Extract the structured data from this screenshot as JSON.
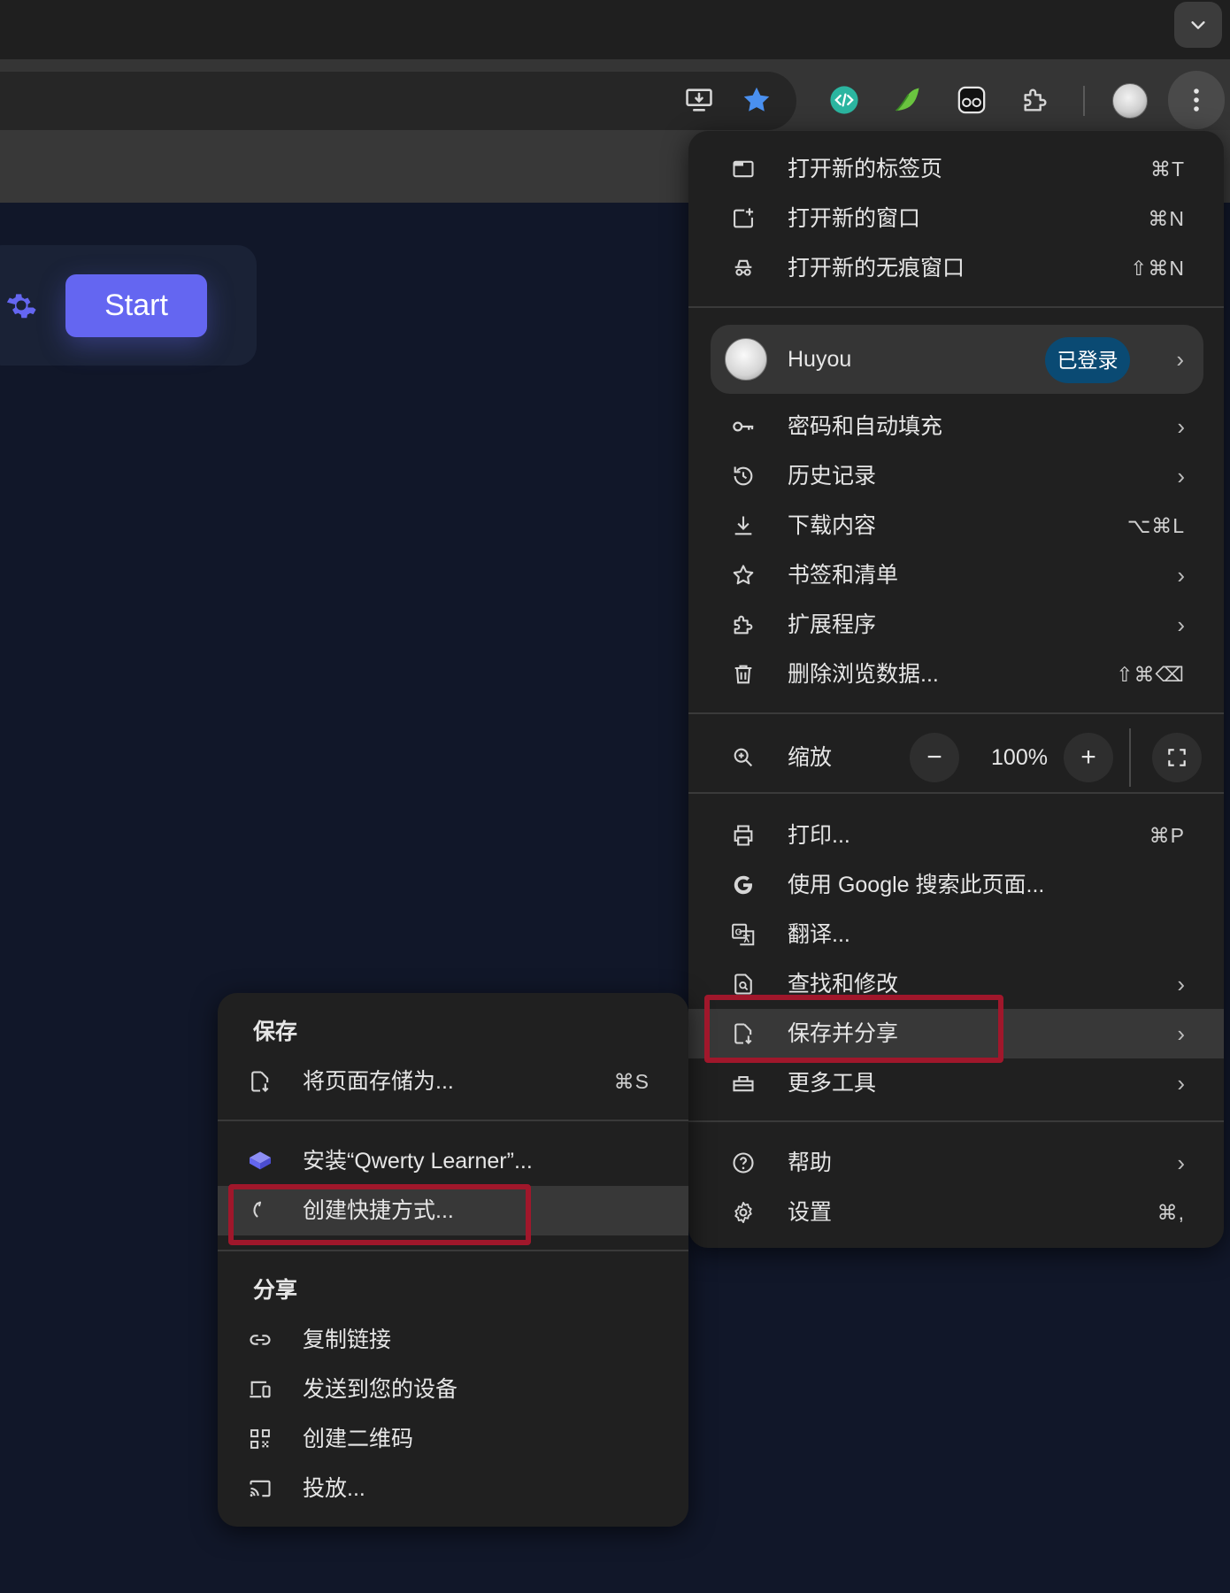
{
  "colors": {
    "accent_button": "#6466f1",
    "bookmark_star": "#4a90f0",
    "signed_in_badge": "#0a4a73",
    "highlight_box": "#a0172b",
    "page_background": "#111729"
  },
  "toolbar": {
    "icons": [
      "install-app-icon",
      "bookmark-star-icon",
      "code-extension-icon",
      "leaf-extension-icon",
      "panda-extension-icon",
      "extensions-puzzle-icon",
      "profile-avatar",
      "kebab-menu-icon"
    ]
  },
  "page": {
    "start_label": "Start"
  },
  "main_menu": {
    "group1": [
      {
        "label": "打开新的标签页",
        "shortcut": "⌘T",
        "icon": "new-tab-icon"
      },
      {
        "label": "打开新的窗口",
        "shortcut": "⌘N",
        "icon": "new-window-icon"
      },
      {
        "label": "打开新的无痕窗口",
        "shortcut": "⇧⌘N",
        "icon": "incognito-icon"
      }
    ],
    "profile": {
      "name": "Huyou",
      "badge": "已登录"
    },
    "group2": [
      {
        "label": "密码和自动填充",
        "icon": "key-icon"
      },
      {
        "label": "历史记录",
        "icon": "history-icon"
      },
      {
        "label": "下载内容",
        "shortcut": "⌥⌘L",
        "icon": "download-icon"
      },
      {
        "label": "书签和清单",
        "icon": "star-outline-icon"
      },
      {
        "label": "扩展程序",
        "icon": "puzzle-icon"
      },
      {
        "label": "删除浏览数据...",
        "shortcut": "⇧⌘⌫",
        "icon": "trash-icon"
      }
    ],
    "zoom": {
      "label": "缩放",
      "minus": "−",
      "value": "100%",
      "plus": "+"
    },
    "group3": [
      {
        "label": "打印...",
        "shortcut": "⌘P",
        "icon": "print-icon"
      },
      {
        "label": "使用 Google 搜索此页面...",
        "icon": "google-icon"
      },
      {
        "label": "翻译...",
        "icon": "translate-icon"
      },
      {
        "label": "查找和修改",
        "icon": "find-icon"
      },
      {
        "label": "保存并分享",
        "icon": "save-share-icon"
      },
      {
        "label": "更多工具",
        "icon": "toolbox-icon"
      }
    ],
    "group4": [
      {
        "label": "帮助",
        "icon": "help-icon"
      },
      {
        "label": "设置",
        "shortcut": "⌘,",
        "icon": "settings-icon"
      }
    ]
  },
  "sub_menu": {
    "save_header": "保存",
    "save_page": {
      "label": "将页面存储为...",
      "shortcut": "⌘S"
    },
    "install_app": {
      "label": "安装“Qwerty Learner”..."
    },
    "create_shortcut": {
      "label": "创建快捷方式..."
    },
    "share_header": "分享",
    "share_items": [
      {
        "label": "复制链接",
        "icon": "link-icon"
      },
      {
        "label": "发送到您的设备",
        "icon": "devices-icon"
      },
      {
        "label": "创建二维码",
        "icon": "qr-code-icon"
      },
      {
        "label": "投放...",
        "icon": "cast-icon"
      }
    ]
  }
}
